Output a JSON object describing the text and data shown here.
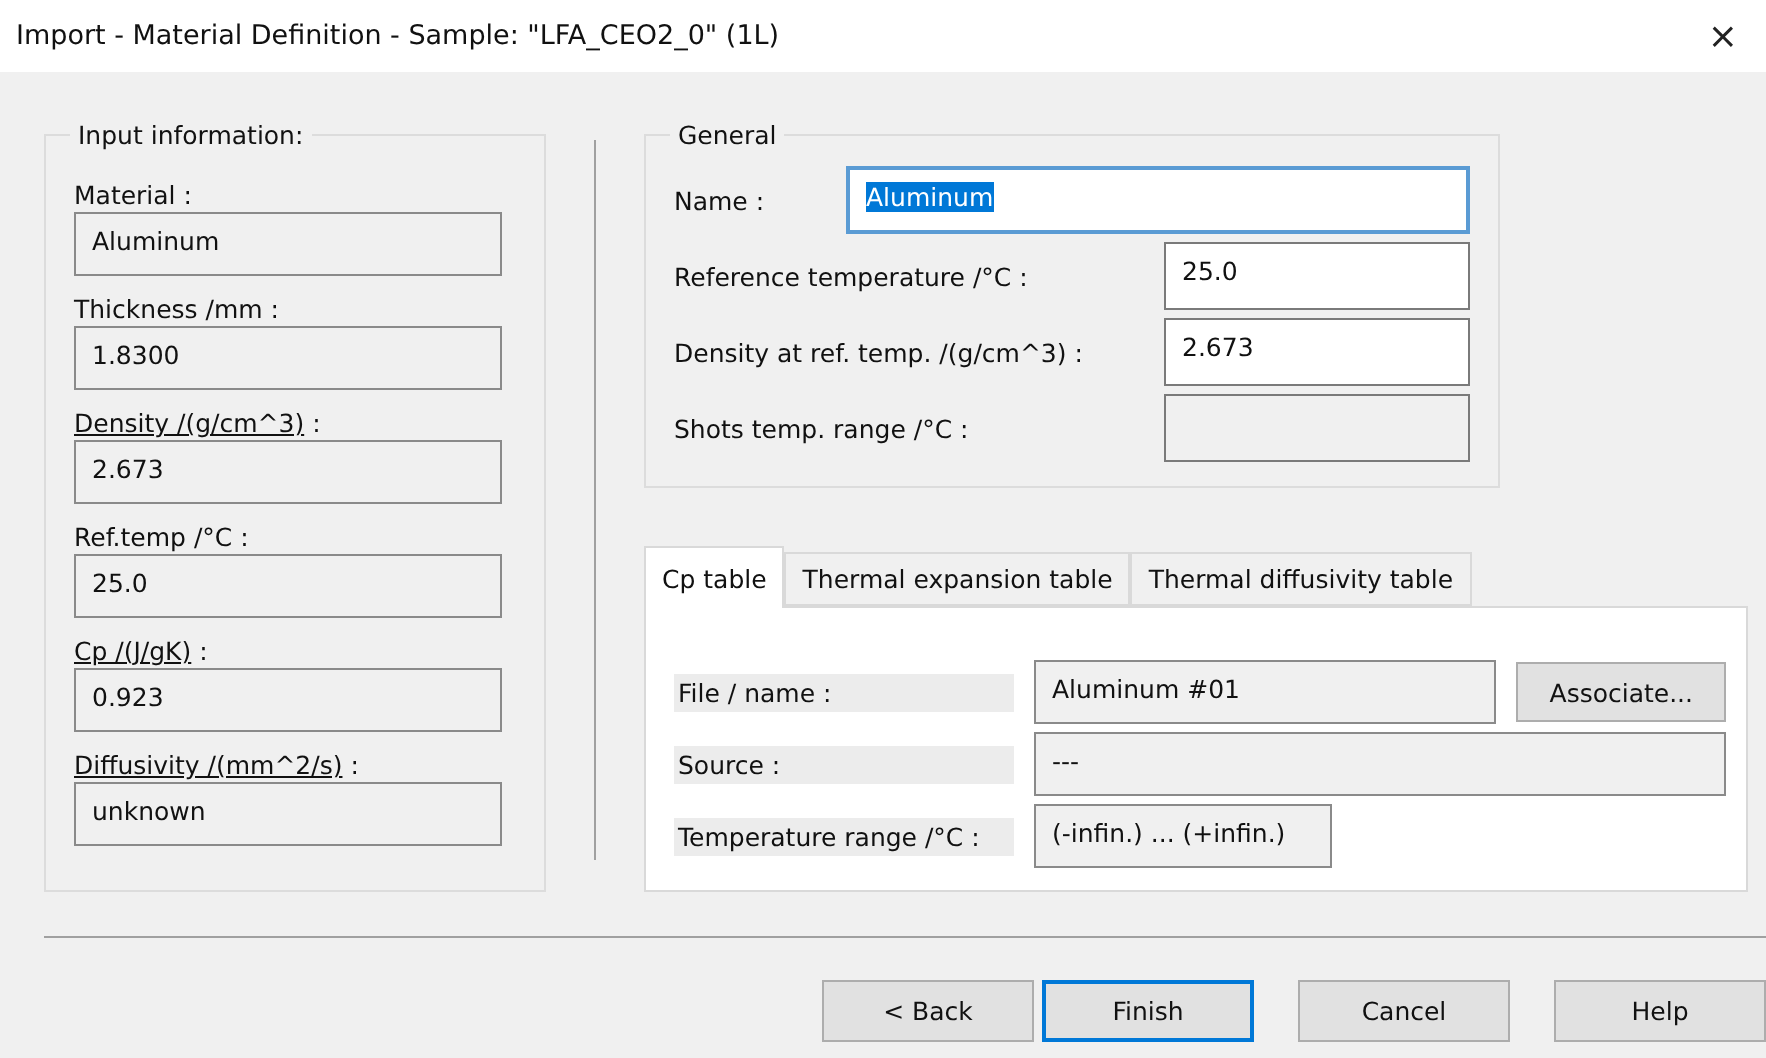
{
  "window": {
    "title": "Import - Material Definition - Sample: \"LFA_CEO2_0\" (1L)",
    "close": "×"
  },
  "input_information": {
    "title": "Input information:",
    "fields": [
      {
        "label": "Material",
        "suffix": " :",
        "link": false,
        "value": "Aluminum"
      },
      {
        "label": "Thickness /mm",
        "suffix": " :",
        "link": false,
        "value": "1.8300"
      },
      {
        "label": "Density /(g/cm^3)",
        "suffix": " :",
        "link": true,
        "value": "2.673"
      },
      {
        "label": "Ref.temp /°C",
        "suffix": " :",
        "link": false,
        "value": "25.0"
      },
      {
        "label": "Cp /(J/gK)",
        "suffix": " :",
        "link": true,
        "value": "0.923"
      },
      {
        "label": "Diffusivity /(mm^2/s)",
        "suffix": " :",
        "link": true,
        "value": "unknown"
      }
    ]
  },
  "general": {
    "title": "General",
    "name_label": "Name :",
    "name_value": "Aluminum",
    "fields": [
      {
        "label": "Reference temperature /°C :",
        "value": "25.0",
        "disabled": false
      },
      {
        "label": "Density at ref. temp. /(g/cm^3) :",
        "value": "2.673",
        "disabled": false
      },
      {
        "label": "Shots temp. range /°C :",
        "disabled": true
      }
    ]
  },
  "tabs": [
    {
      "label": "Cp table",
      "selected": true
    },
    {
      "label": "Thermal expansion table",
      "selected": false
    },
    {
      "label": "Thermal diffusivity table",
      "selected": false
    }
  ],
  "cp_table": {
    "rows": [
      {
        "label": "File / name :",
        "value": "Aluminum #01",
        "button": "Associate..."
      },
      {
        "label": "Source :",
        "value": "---"
      },
      {
        "label": "Temperature range /°C :",
        "value": "(-infin.) ... (+infin.)"
      }
    ]
  },
  "buttons": [
    {
      "label": "< Back",
      "selected": false
    },
    {
      "label": "Finish",
      "selected": true
    },
    {
      "label": "Cancel",
      "selected": false
    },
    {
      "label": "Help",
      "selected": false
    }
  ]
}
